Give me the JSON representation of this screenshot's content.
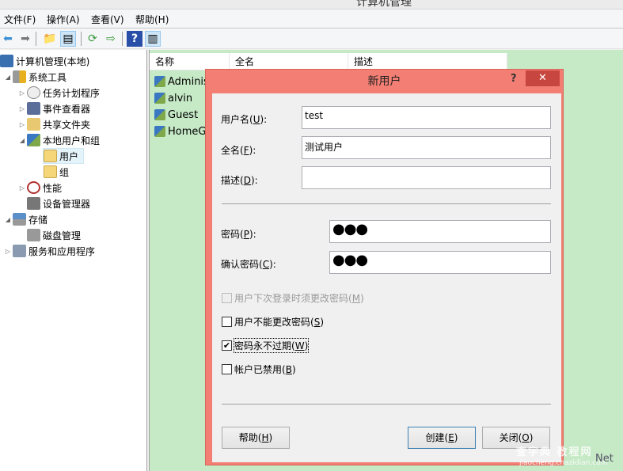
{
  "window": {
    "title": "计算机管理"
  },
  "menu": [
    {
      "label": "文件(F)"
    },
    {
      "label": "操作(A)"
    },
    {
      "label": "查看(V)"
    },
    {
      "label": "帮助(H)"
    }
  ],
  "toolbar": {
    "icons": [
      "back-icon",
      "forward-icon",
      "up-folder-icon",
      "show-hide-tree-icon",
      "refresh-icon",
      "export-list-icon",
      "help-icon",
      "show-hide-action-pane-icon"
    ]
  },
  "tree": {
    "items": [
      {
        "label": "计算机管理(本地)",
        "expanded": true
      },
      {
        "label": "系统工具",
        "expanded": true
      },
      {
        "label": "任务计划程序",
        "expanded": false
      },
      {
        "label": "事件查看器",
        "expanded": false
      },
      {
        "label": "共享文件夹",
        "expanded": false
      },
      {
        "label": "本地用户和组",
        "expanded": true
      },
      {
        "label": "用户",
        "selected": true
      },
      {
        "label": "组"
      },
      {
        "label": "性能",
        "expanded": false
      },
      {
        "label": "设备管理器"
      },
      {
        "label": "存储",
        "expanded": true
      },
      {
        "label": "磁盘管理"
      },
      {
        "label": "服务和应用程序",
        "expanded": false
      }
    ]
  },
  "list": {
    "columns": [
      "名称",
      "全名",
      "描述"
    ],
    "rows": [
      {
        "name": "Administ"
      },
      {
        "name": "alvin"
      },
      {
        "name": "Guest"
      },
      {
        "name": "HomeGr"
      }
    ]
  },
  "dialog": {
    "title": "新用户",
    "help_glyph": "?",
    "close_glyph": "✕",
    "fields": {
      "username": {
        "label": "用户名",
        "key": "U",
        "value": "test"
      },
      "fullname": {
        "label": "全名",
        "key": "F",
        "value": "测试用户"
      },
      "description": {
        "label": "描述",
        "key": "D",
        "value": ""
      },
      "password": {
        "label": "密码",
        "key": "P",
        "value": "●●●"
      },
      "confirm": {
        "label": "确认密码",
        "key": "C",
        "value": "●●●"
      }
    },
    "checkboxes": [
      {
        "label": "用户下次登录时须更改密码",
        "key": "M",
        "checked": false,
        "disabled": true
      },
      {
        "label": "用户不能更改密码",
        "key": "S",
        "checked": false,
        "disabled": false
      },
      {
        "label": "密码永不过期",
        "key": "W",
        "checked": true,
        "disabled": false
      },
      {
        "label": "帐户已禁用",
        "key": "B",
        "checked": false,
        "disabled": false
      }
    ],
    "buttons": {
      "help": {
        "label": "帮助",
        "key": "H"
      },
      "create": {
        "label": "创建",
        "key": "E"
      },
      "close": {
        "label": "关闭",
        "key": "O"
      }
    },
    "colors": {
      "frame": "#f37e73",
      "close_button": "#c7463f"
    }
  },
  "watermark": {
    "text": "查字典 教程网",
    "sub": "jiaocheng.chazidian.com",
    "suffix": "Net"
  }
}
